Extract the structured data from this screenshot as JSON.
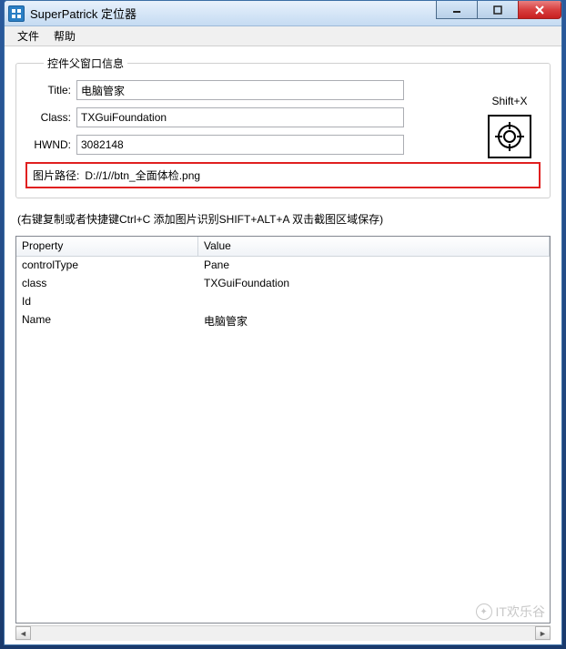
{
  "window": {
    "title": "SuperPatrick 定位器"
  },
  "menu": {
    "file": "文件",
    "help": "帮助"
  },
  "group": {
    "legend": "控件父窗口信息",
    "title_label": "Title:",
    "title_value": "电脑管家",
    "class_label": "Class:",
    "class_value": "TXGuiFoundation",
    "hwnd_label": "HWND:",
    "hwnd_value": "3082148",
    "imgpath_label": "图片路径:",
    "imgpath_value": "D://1//btn_全面体检.png"
  },
  "shortcut": {
    "label": "Shift+X"
  },
  "hint": "(右键复制或者快捷键Ctrl+C   添加图片识别SHIFT+ALT+A 双击截图区域保存)",
  "listview": {
    "header_prop": "Property",
    "header_val": "Value",
    "rows": [
      {
        "prop": "controlType",
        "val": "Pane"
      },
      {
        "prop": "class",
        "val": "TXGuiFoundation"
      },
      {
        "prop": "Id",
        "val": ""
      },
      {
        "prop": "Name",
        "val": "电脑管家"
      }
    ]
  },
  "watermark": "IT欢乐谷"
}
